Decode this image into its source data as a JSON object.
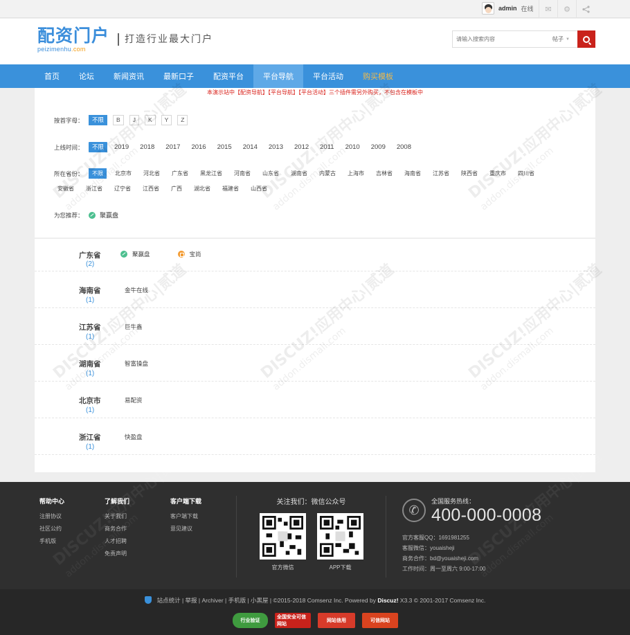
{
  "topbar": {
    "username": "admin",
    "status": "在线",
    "icons": [
      "mail-icon",
      "gear-icon",
      "share-icon"
    ]
  },
  "header": {
    "logo_cn": "配资门户",
    "logo_en_main": "peizimenhu",
    "logo_en_tld": ".com",
    "slogan": "打造行业最大门户",
    "search": {
      "placeholder": "请输入搜索内容",
      "type": "帖子"
    }
  },
  "nav": {
    "items": [
      "首页",
      "论坛",
      "新闻资讯",
      "最新口子",
      "配资平台",
      "平台导航",
      "平台活动",
      "购买模板"
    ],
    "active": "平台导航"
  },
  "notice": "本演示站中【配资导航】【平台导航】【平台活动】三个插件需另外购买，不包含在模板中",
  "filter": {
    "letter_label": "按首字母：",
    "letters": [
      "不限",
      "B",
      "J",
      "K",
      "Y",
      "Z"
    ],
    "year_label": "上线时间：",
    "years": [
      "不限",
      "2019",
      "2018",
      "2017",
      "2016",
      "2015",
      "2014",
      "2013",
      "2012",
      "2011",
      "2010",
      "2009",
      "2008"
    ],
    "prov_label": "所在省份：",
    "provinces": [
      "不限",
      "北京市",
      "河北省",
      "广东省",
      "黑龙江省",
      "河南省",
      "山东省",
      "湖南省",
      "内蒙古",
      "上海市",
      "吉林省",
      "海南省",
      "江苏省",
      "陕西省",
      "重庆市",
      "四川省",
      "安徽省",
      "浙江省",
      "辽宁省",
      "江西省",
      "广西",
      "湖北省",
      "福建省",
      "山西省"
    ],
    "rec_label": "为您推荐：",
    "rec_item": "聚赢盘"
  },
  "results": [
    {
      "province": "广东省",
      "count": "(2)",
      "platforms": [
        "聚赢盘",
        "宝尚"
      ]
    },
    {
      "province": "海南省",
      "count": "(1)",
      "platforms": [
        "金牛在线"
      ]
    },
    {
      "province": "江苏省",
      "count": "(1)",
      "platforms": [
        "巨牛鑫"
      ]
    },
    {
      "province": "湖南省",
      "count": "(1)",
      "platforms": [
        "智富操盘"
      ]
    },
    {
      "province": "北京市",
      "count": "(1)",
      "platforms": [
        "易配资"
      ]
    },
    {
      "province": "浙江省",
      "count": "(1)",
      "platforms": [
        "快盈盘"
      ]
    }
  ],
  "footer": {
    "cols": [
      {
        "title": "帮助中心",
        "links": [
          "注册协议",
          "社区公约",
          "手机版"
        ]
      },
      {
        "title": "了解我们",
        "links": [
          "关于我们",
          "商务合作",
          "人才招聘",
          "免责声明"
        ]
      },
      {
        "title": "客户端下载",
        "links": [
          "客户端下载",
          "意见建议"
        ]
      }
    ],
    "follow_title": "关注我们：微信公众号",
    "qr1_caption": "官方微信",
    "qr2_caption": "APP下载",
    "hotline_label": "全国服务热线：",
    "hotline": "400-000-0008",
    "contact": [
      "官方客服QQ：1691981255",
      "客服微信：youaisheji",
      "商务合作：bd@youaisheji.com",
      "工作时间：周一至周六 9:00-17:00"
    ]
  },
  "bottom": {
    "links": "站点统计  |  举报  | Archiver  |  手机版  |  小黑屋  |    ©2015-2018  Comsenz Inc.  Powered by",
    "brand": "Discuz!",
    "version": " X3.3 © 2001-2017 Comsenz Inc.",
    "badges": [
      "行业验证",
      "全国安全可信网站",
      "网站信用",
      "可信网站"
    ]
  },
  "watermark": {
    "main": "DISCUZ!应用中心|贰道",
    "sub": "addon.dismall.com"
  },
  "colors": {
    "nav": "#3a91db",
    "accent_red": "#c9221b",
    "footer": "#2f2f2f"
  }
}
